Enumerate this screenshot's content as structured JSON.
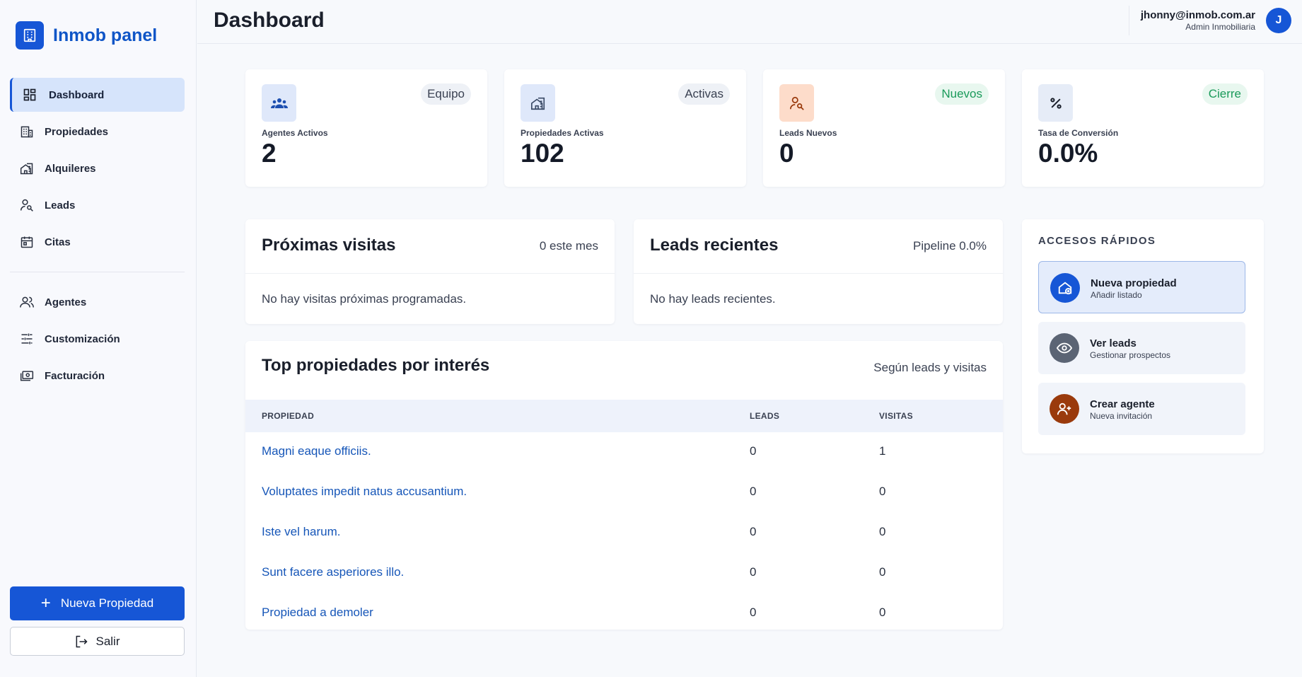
{
  "sidebar": {
    "brand": "Inmob panel",
    "items": [
      {
        "label": "Dashboard",
        "icon": "dashboard-icon"
      },
      {
        "label": "Propiedades",
        "icon": "building-icon"
      },
      {
        "label": "Alquileres",
        "icon": "home-rent-icon"
      },
      {
        "label": "Leads",
        "icon": "person-search-icon"
      },
      {
        "label": "Citas",
        "icon": "calendar-icon"
      },
      {
        "label": "Agentes",
        "icon": "people-icon"
      },
      {
        "label": "Customización",
        "icon": "sliders-icon"
      },
      {
        "label": "Facturación",
        "icon": "billing-icon"
      }
    ],
    "new_property_label": "Nueva Propiedad",
    "logout_label": "Salir"
  },
  "header": {
    "title": "Dashboard",
    "user_email": "jhonny@inmob.com.ar",
    "user_role": "Admin Inmobiliaria",
    "avatar_initial": "J"
  },
  "stats": [
    {
      "label": "Agentes Activos",
      "value": "2",
      "badge": "Equipo",
      "icon": "group-icon"
    },
    {
      "label": "Propiedades Activas",
      "value": "102",
      "badge": "Activas",
      "icon": "home-building-icon"
    },
    {
      "label": "Leads Nuevos",
      "value": "0",
      "badge": "Nuevos",
      "icon": "person-search-icon"
    },
    {
      "label": "Tasa de Conversión",
      "value": "0.0%",
      "badge": "Cierre",
      "icon": "percent-icon"
    }
  ],
  "visits": {
    "title": "Próximas visitas",
    "meta": "0 este mes",
    "empty": "No hay visitas próximas programadas."
  },
  "leads": {
    "title": "Leads recientes",
    "meta": "Pipeline 0.0%",
    "empty": "No hay leads recientes."
  },
  "top_properties": {
    "title": "Top propiedades por interés",
    "meta": "Según leads y visitas",
    "columns": [
      "PROPIEDAD",
      "LEADS",
      "VISITAS"
    ],
    "rows": [
      {
        "name": "Magni eaque officiis.",
        "leads": "0",
        "visits": "1"
      },
      {
        "name": "Voluptates impedit natus accusantium.",
        "leads": "0",
        "visits": "0"
      },
      {
        "name": "Iste vel harum.",
        "leads": "0",
        "visits": "0"
      },
      {
        "name": "Sunt facere asperiores illo.",
        "leads": "0",
        "visits": "0"
      },
      {
        "name": "Propiedad a demoler",
        "leads": "0",
        "visits": "0"
      }
    ]
  },
  "quick_access": {
    "title": "ACCESOS RÁPIDOS",
    "items": [
      {
        "label": "Nueva propiedad",
        "sub": "Añadir listado",
        "icon": "home-add-icon"
      },
      {
        "label": "Ver leads",
        "sub": "Gestionar prospectos",
        "icon": "eye-icon"
      },
      {
        "label": "Crear agente",
        "sub": "Nueva invitación",
        "icon": "person-add-icon"
      }
    ]
  },
  "colors": {
    "primary": "#1656d6",
    "badge_green": "#1a9a5a",
    "link": "#1656b8",
    "orange": "#9a3a0c"
  }
}
